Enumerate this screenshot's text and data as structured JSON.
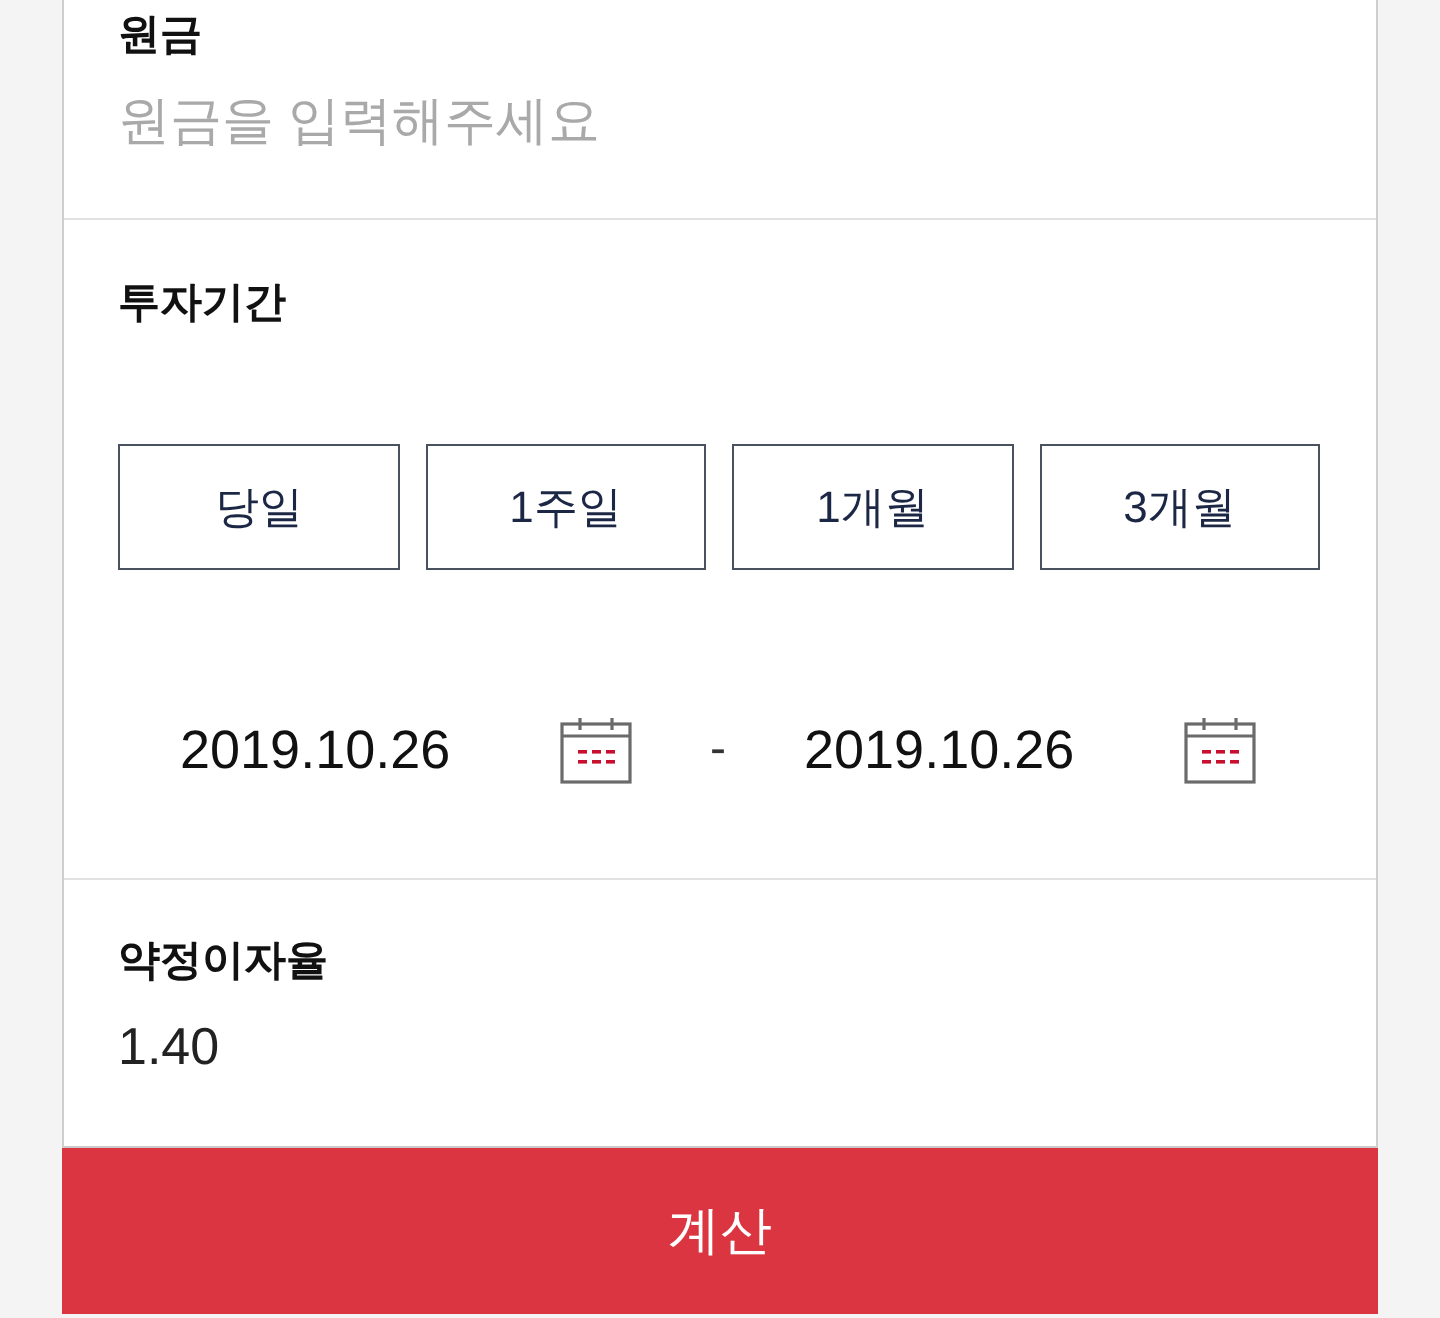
{
  "principal": {
    "label": "원금",
    "placeholder": "원금을 입력해주세요"
  },
  "period": {
    "label": "투자기간",
    "options": [
      {
        "label": "당일",
        "selected": false
      },
      {
        "label": "1주일",
        "selected": false
      },
      {
        "label": "1개월",
        "selected": false
      },
      {
        "label": "3개월",
        "selected": false
      }
    ],
    "start_date": "2019.10.26",
    "separator": "-",
    "end_date": "2019.10.26"
  },
  "rate": {
    "label": "약정이자율",
    "value": "1.40"
  },
  "calculate_button": {
    "label": "계산"
  }
}
